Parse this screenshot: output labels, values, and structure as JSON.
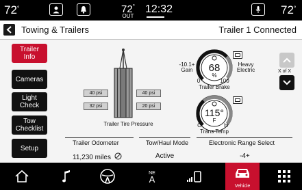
{
  "status_bar": {
    "temp_left": "72",
    "temp_left_unit": "°",
    "outside_temp": "72",
    "outside_temp_unit": "°",
    "outside_label": "OUT",
    "time": "12:32",
    "temp_right": "72",
    "temp_right_unit": "°"
  },
  "header": {
    "title": "Towing & Trailers",
    "connection_status": "Trailer 1 Connected"
  },
  "side_menu": [
    {
      "label_line1": "Trailer",
      "label_line2": "Info"
    },
    {
      "label_line1": "Cameras",
      "label_line2": ""
    },
    {
      "label_line1": "Light",
      "label_line2": "Check"
    },
    {
      "label_line1": "Tow",
      "label_line2": "Checklist"
    },
    {
      "label_line1": "Setup",
      "label_line2": ""
    }
  ],
  "tire_pressure": {
    "title": "Trailer Tire Pressure",
    "left_top": "40 psi",
    "left_bottom": "32 psi",
    "right_top": "40 psi",
    "right_bottom": "20 psi"
  },
  "trailer_brake": {
    "title": "Trailer Brake",
    "value": "68",
    "unit": "%",
    "min": "0",
    "max": "100",
    "left_label_line1": "-10.1+",
    "left_label_line2": "Gain",
    "right_label_line1": "Heavy",
    "right_label_line2": "Electric",
    "level": 0.68
  },
  "trans_temp": {
    "title": "Trans Temp",
    "value": "115°",
    "unit": "F",
    "min": "C",
    "max": "H",
    "level": 0.35
  },
  "pager": {
    "label": "X of X"
  },
  "info": {
    "odometer_label": "Trailer Odometer",
    "odometer_value": "11,230 miles",
    "mode_label": "Tow/Haul Mode",
    "mode_value": "Active",
    "range_label": "Electronic Range Select",
    "range_value": "-4+"
  },
  "nav": {
    "compass_label": "NE",
    "compass_letter": "A",
    "vehicle_label": "Vehicle"
  },
  "colors": {
    "accent": "#c8102e"
  }
}
